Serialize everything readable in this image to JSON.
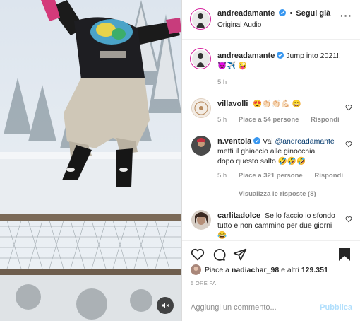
{
  "header": {
    "username": "andreadamante",
    "follow_label": "Segui già",
    "audio_label": "Original Audio",
    "more_icon": "more-horizontal-icon"
  },
  "caption": {
    "username": "andreadamante",
    "text": "Jump into 2021!!",
    "emoji_line": "😈✈️ 🤪",
    "time": "5 h"
  },
  "comments": [
    {
      "username": "villavolli",
      "text": "😍👏🏻👏🏻💪🏻 😀",
      "time": "5 h",
      "likes": "Piace a 54 persone",
      "reply": "Rispondi"
    },
    {
      "username": "n.ventola",
      "mention": "@andreadamante",
      "prefix": "Vai",
      "text_line2": "metti il ghiaccio alle ginocchia",
      "text_line3": "dopo questo salto 🤣🤣🤣",
      "time": "5 h",
      "likes": "Piace a 321 persone",
      "reply": "Rispondi",
      "view_replies": "Visualizza le risposte (8)"
    },
    {
      "username": "carlitadolce",
      "text_line1": "Se lo faccio io sfondo",
      "text_line2": "tutto e non cammino per due giorni",
      "text_line3": "😂"
    }
  ],
  "actions": {
    "likes_prefix": "Piace a",
    "likes_user": "nadiachar_98",
    "likes_suffix": "e altri",
    "likes_count": "129.351",
    "timestamp": "5 ORE FA"
  },
  "input": {
    "placeholder": "Aggiungi un commento...",
    "post_label": "Pubblica"
  },
  "colors": {
    "accent_blue": "#0095f6",
    "post_disabled": "#b2dffc",
    "verified": "#3897f0",
    "text": "#262626",
    "muted": "#8e8e8e"
  }
}
